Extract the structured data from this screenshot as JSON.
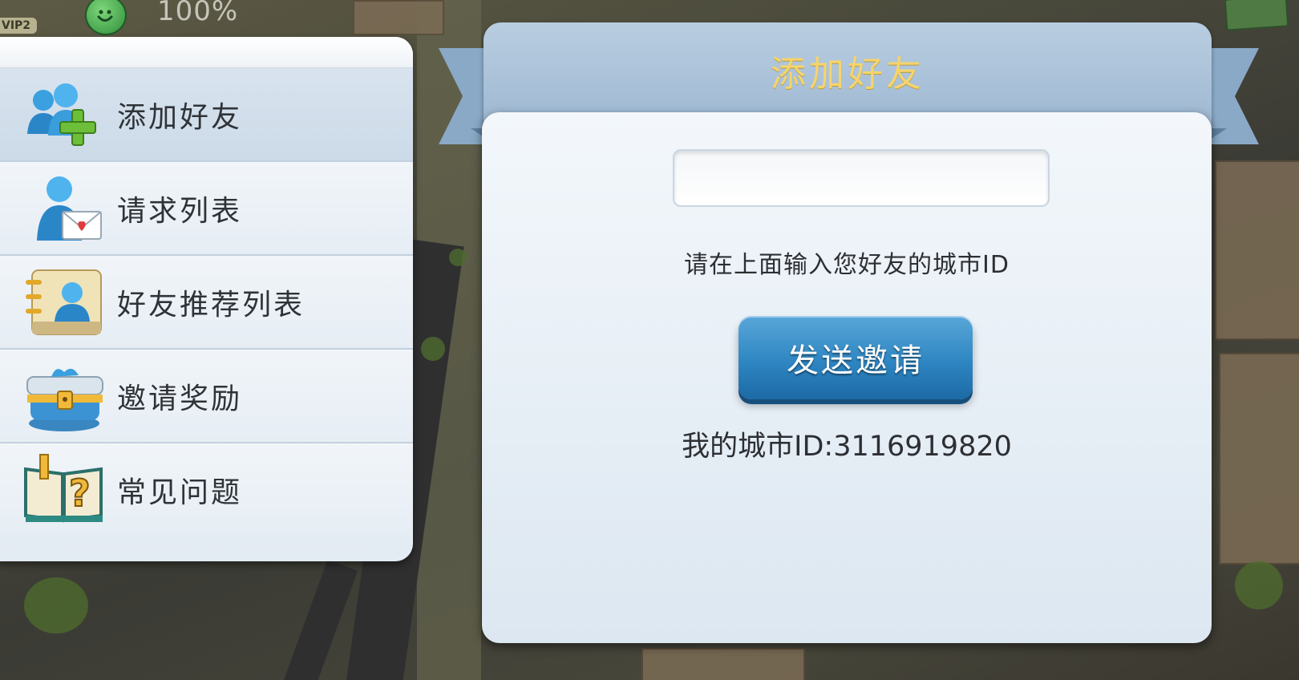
{
  "hud": {
    "vip": "VIP2",
    "happiness": "100%"
  },
  "menu": {
    "items": [
      {
        "label": "添加好友",
        "icon": "add-friend-icon",
        "active": true
      },
      {
        "label": "请求列表",
        "icon": "friend-request-mail-icon",
        "active": false
      },
      {
        "label": "好友推荐列表",
        "icon": "recommended-friends-icon",
        "active": false
      },
      {
        "label": "邀请奖励",
        "icon": "reward-chest-icon",
        "active": false
      },
      {
        "label": "常见问题",
        "icon": "faq-book-icon",
        "active": false
      }
    ]
  },
  "dialog": {
    "title": "添加好友",
    "input_value": "",
    "hint": "请在上面输入您好友的城市ID",
    "send_label": "发送邀请",
    "my_city_id": "我的城市ID:3116919820"
  },
  "colors": {
    "title_gold": "#f6d46c",
    "button_blue": "#2e86c2",
    "panel_bg": "#e6edf4",
    "header_bg": "#9eb9d3"
  }
}
